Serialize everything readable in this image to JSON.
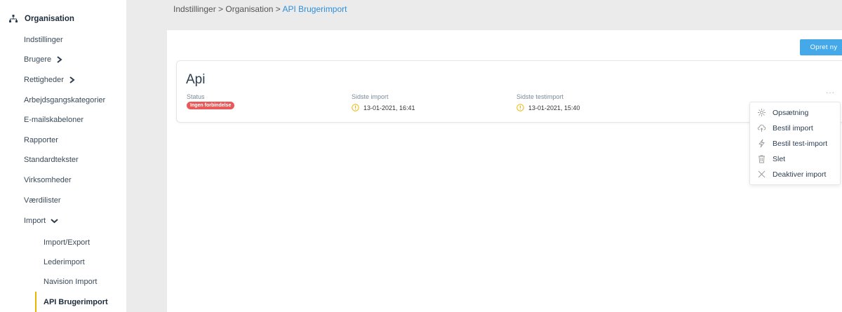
{
  "sidebar": {
    "section_title": "Organisation",
    "items": [
      {
        "label": "Indstillinger"
      },
      {
        "label": "Brugere"
      },
      {
        "label": "Rettigheder"
      },
      {
        "label": "Arbejdsgangskategorier"
      },
      {
        "label": "E-mailskabeloner"
      },
      {
        "label": "Rapporter"
      },
      {
        "label": "Standardtekster"
      },
      {
        "label": "Virksomheder"
      },
      {
        "label": "Værdilister"
      },
      {
        "label": "Import"
      }
    ],
    "import_subitems": [
      {
        "label": "Import/Export"
      },
      {
        "label": "Lederimport"
      },
      {
        "label": "Navision Import"
      },
      {
        "label": "API Brugerimport"
      }
    ]
  },
  "breadcrumb": {
    "part1": "Indstillinger",
    "sep": " > ",
    "part2": "Organisation",
    "current": "API Brugerimport"
  },
  "toolbar": {
    "create_label": "Opret ny"
  },
  "card": {
    "title": "Api",
    "status_label": "Status",
    "status_badge": "Ingen forbindelse",
    "last_import_label": "Sidste import",
    "last_import_value": "13-01-2021, 16:41",
    "last_test_label": "Sidste testimport",
    "last_test_value": "13-01-2021, 15:40",
    "more": "···"
  },
  "menu": {
    "items": [
      {
        "label": "Opsætning",
        "icon": "settings-icon"
      },
      {
        "label": "Bestil import",
        "icon": "cloud-upload-icon"
      },
      {
        "label": "Bestil test-import",
        "icon": "lightning-icon"
      },
      {
        "label": "Slet",
        "icon": "trash-icon"
      },
      {
        "label": "Deaktiver import",
        "icon": "close-icon"
      }
    ]
  },
  "colors": {
    "accent": "#45a8e8",
    "link": "#2f8fd8",
    "danger": "#e85a5a",
    "warning": "#f0b400",
    "active_bar": "#e8b500"
  }
}
